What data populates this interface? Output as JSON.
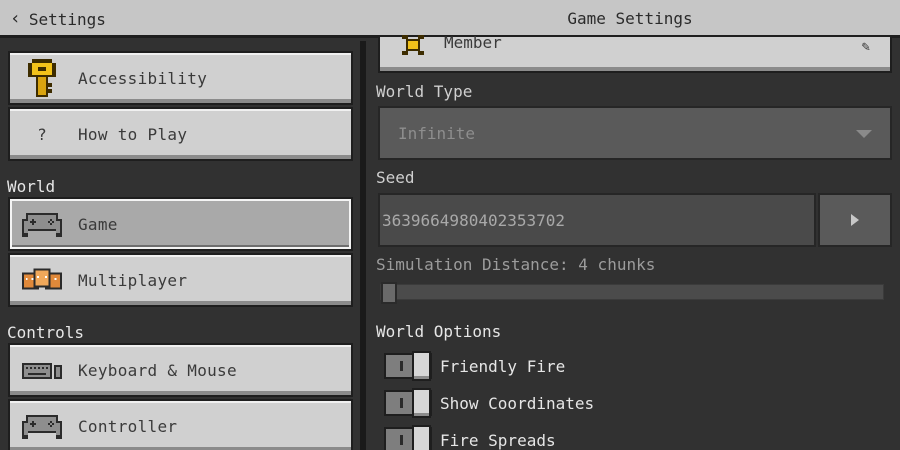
{
  "topbar": {
    "back_label": "Settings",
    "title": "Game Settings"
  },
  "sidebar": {
    "general_items": [
      {
        "label": "Accessibility",
        "icon": "key-icon"
      },
      {
        "label": "How to Play",
        "icon": "question-icon"
      }
    ],
    "world_section": "World",
    "world_items": [
      {
        "label": "Game",
        "icon": "gamepad-icon",
        "selected": true
      },
      {
        "label": "Multiplayer",
        "icon": "multiplayer-icon",
        "selected": false
      }
    ],
    "controls_section": "Controls",
    "controls_items": [
      {
        "label": "Keyboard & Mouse",
        "icon": "keyboard-icon"
      },
      {
        "label": "Controller",
        "icon": "gamepad-icon"
      }
    ]
  },
  "game_settings": {
    "permission": {
      "value": "Member",
      "icon": "member-icon"
    },
    "world_type": {
      "label": "World Type",
      "value": "Infinite"
    },
    "seed": {
      "label": "Seed",
      "value": "3639664980402353702"
    },
    "simulation_distance": {
      "label": "Simulation Distance: 4 chunks",
      "level": 0
    },
    "world_options": {
      "label": "World Options",
      "toggles": [
        {
          "label": "Friendly Fire",
          "on": true
        },
        {
          "label": "Show Coordinates",
          "on": true
        },
        {
          "label": "Fire Spreads",
          "on": true
        }
      ]
    }
  },
  "colors": {
    "background": "#313131",
    "button": "#d0d0d0",
    "button_selected": "#a9a9a9",
    "topbar": "#c6c6c6"
  }
}
